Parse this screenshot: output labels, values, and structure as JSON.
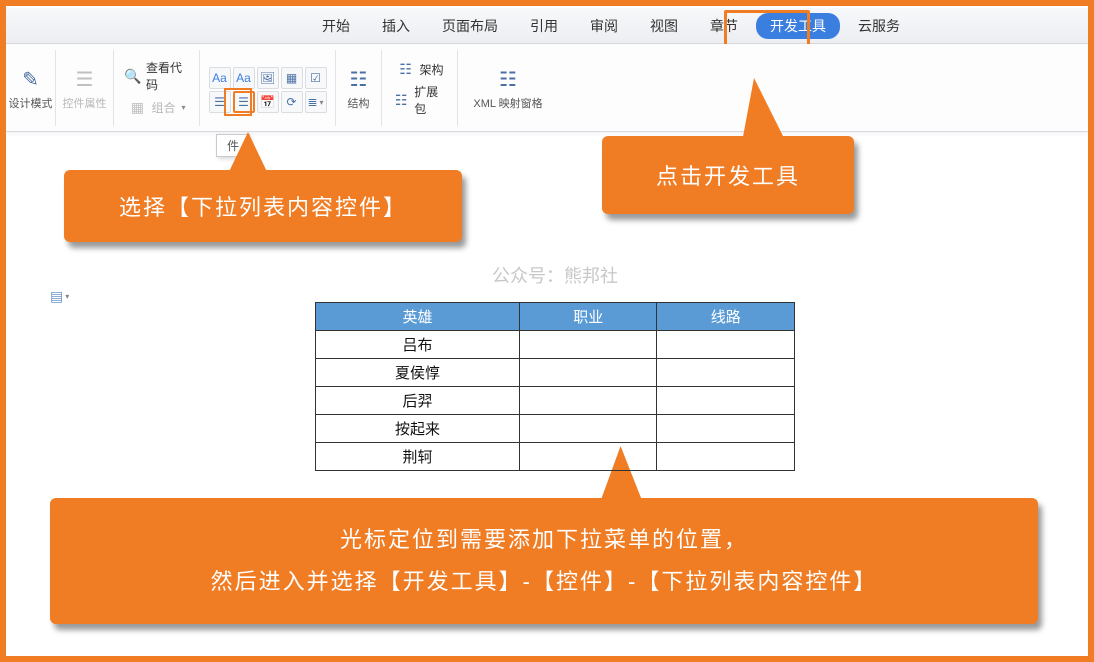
{
  "tabs": {
    "start": "开始",
    "insert": "插入",
    "layout": "页面布局",
    "reference": "引用",
    "review": "审阅",
    "view": "视图",
    "chapter": "章节",
    "dev": "开发工具",
    "cloud": "云服务"
  },
  "ribbon": {
    "design_mode": "设计模式",
    "control_props": "控件属性",
    "view_code": "查看代码",
    "group": "组合",
    "structure": "结构",
    "schema": "架构",
    "extensions": "扩展包",
    "xml_map": "XML 映射窗格"
  },
  "tooltip_partial": "件",
  "callout1": "选择【下拉列表内容控件】",
  "callout2": "点击开发工具",
  "callout3_line1": "光标定位到需要添加下拉菜单的位置，",
  "callout3_line2": "然后进入并选择【开发工具】-【控件】-【下拉列表内容控件】",
  "doc_watermark": "公众号：熊邦社",
  "table": {
    "headers": {
      "c1": "英雄",
      "c2": "职业",
      "c3": "线路"
    },
    "rows": [
      {
        "c1": "吕布",
        "c2": "",
        "c3": ""
      },
      {
        "c1": "夏侯惇",
        "c2": "",
        "c3": ""
      },
      {
        "c1": "后羿",
        "c2": "",
        "c3": ""
      },
      {
        "c1": "按起来",
        "c2": "",
        "c3": ""
      },
      {
        "c1": "荆轲",
        "c2": "",
        "c3": ""
      }
    ]
  }
}
